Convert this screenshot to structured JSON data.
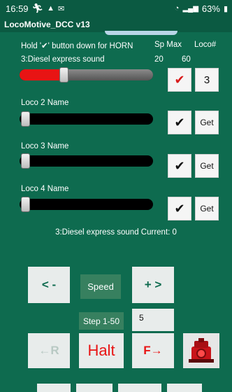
{
  "status_bar": {
    "time": "16:59",
    "icons_left": [
      "run-icon",
      "alert-icon",
      "mail-icon"
    ],
    "battery": "63%"
  },
  "app": {
    "title": "LocoMotive_DCC v13"
  },
  "header": {
    "hint": "Hold '✔' button down for HORN",
    "col_sp_max": "Sp Max",
    "col_loco": "Loco#"
  },
  "loco1": {
    "name": "3:Diesel express sound",
    "speed_value": "20",
    "sp_max": "60",
    "level": 0.33,
    "check": "✔",
    "loco_number": "3"
  },
  "loco2": {
    "name": "Loco 2 Name",
    "level": 0.0,
    "check": "✔",
    "get_label": "Get"
  },
  "loco3": {
    "name": "Loco 3 Name",
    "level": 0.0,
    "check": "✔",
    "get_label": "Get"
  },
  "loco4": {
    "name": "Loco 4 Name",
    "level": 0.0,
    "check": "✔",
    "get_label": "Get"
  },
  "current_status": "3:Diesel express sound  Current: 0",
  "controls": {
    "minus_label": "< -",
    "speed_label": "Speed",
    "plus_label": "+ >",
    "step_label": "Step 1-50",
    "step_value": "5",
    "reverse_label": "←R",
    "halt_label": "Halt",
    "forward_label": "F→"
  },
  "colors": {
    "background": "#0e6b4f",
    "slider_active": "#e81414",
    "button_bg": "#e8eceb"
  }
}
